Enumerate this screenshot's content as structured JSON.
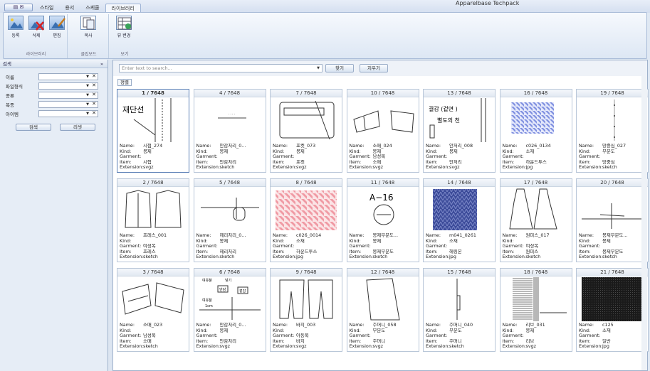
{
  "app": {
    "title": "Apparelbase Techpack",
    "app_button": "",
    "tabs": [
      "스타일",
      "용서",
      "스케줄",
      "라이브러리"
    ],
    "active_tab": 3
  },
  "ribbon": {
    "groups": [
      {
        "label": "라이브러리",
        "buttons": [
          {
            "label": "등록",
            "icon": "register-image-icon"
          },
          {
            "label": "삭제",
            "icon": "delete-image-icon"
          },
          {
            "label": "편집",
            "icon": "edit-image-icon"
          }
        ]
      },
      {
        "label": "클립보드",
        "buttons": [
          {
            "label": "복사",
            "icon": "copy-icon"
          }
        ]
      },
      {
        "label": "보기",
        "buttons": [
          {
            "label": "뷰 변경",
            "icon": "view-change-icon"
          }
        ]
      }
    ]
  },
  "search_panel": {
    "title": "검색",
    "pin": "»",
    "fields": [
      {
        "label": "이름"
      },
      {
        "label": "파일형식"
      },
      {
        "label": "종류"
      },
      {
        "label": "복종"
      },
      {
        "label": "아이템"
      }
    ],
    "search_button": "검색",
    "reset_button": "리셋"
  },
  "searchbar": {
    "placeholder": "Enter text to search...",
    "find_button": "찾기",
    "clear_button": "지우기"
  },
  "sort_label": "정렬",
  "labels": {
    "name": "Name:",
    "kind": "Kind:",
    "garment": "Garment:",
    "item": "Item:",
    "extension": "Extension:"
  },
  "cards": [
    {
      "index": "1 / 7648",
      "name": "시접_274",
      "kind": "봉제",
      "garment": "",
      "item": "시접",
      "ext": "svgz",
      "thumb": "seam",
      "selected": true
    },
    {
      "index": "4 / 7648",
      "name": "안감처리_0...",
      "kind": "봉제",
      "garment": "",
      "item": "안감처리",
      "ext": "sketch",
      "thumb": "lining"
    },
    {
      "index": "7 / 7648",
      "name": "포켓_073",
      "kind": "봉제",
      "garment": "",
      "item": "포켓",
      "ext": "svgz",
      "thumb": "pocket"
    },
    {
      "index": "10 / 7648",
      "name": "소매_024",
      "kind": "봉제",
      "garment": "남성복",
      "item": "소매",
      "ext": "svgz",
      "thumb": "sleeve"
    },
    {
      "index": "13 / 7648",
      "name": "안처리_008",
      "kind": "봉제",
      "garment": "",
      "item": "안처리",
      "ext": "svgz",
      "thumb": "textbox"
    },
    {
      "index": "16 / 7648",
      "name": "c026_0134",
      "kind": "소재",
      "garment": "",
      "item": "하운드투스",
      "ext": "jpg",
      "thumb": "houndblue"
    },
    {
      "index": "19 / 7648",
      "name": "망중심_027",
      "kind": "부분도",
      "garment": "",
      "item": "망중심",
      "ext": "sketch",
      "thumb": "dots"
    },
    {
      "index": "2 / 7648",
      "name": "프레스_001",
      "kind": "",
      "garment": "여성복",
      "item": "프레스",
      "ext": "sketch",
      "thumb": "coat"
    },
    {
      "index": "5 / 7648",
      "name": "헤리처리_0...",
      "kind": "봉제",
      "garment": "",
      "item": "헤리처리",
      "ext": "sketch",
      "thumb": "hem"
    },
    {
      "index": "8 / 7648",
      "name": "c026_0014",
      "kind": "소재",
      "garment": "",
      "item": "하운드투스",
      "ext": "jpg",
      "thumb": "houndred"
    },
    {
      "index": "11 / 7648",
      "name": "봉제부분도...",
      "kind": "봉제",
      "garment": "",
      "item": "봉제부분도",
      "ext": "sketch",
      "thumb": "a16"
    },
    {
      "index": "14 / 7648",
      "name": "m041_0261",
      "kind": "소재",
      "garment": "",
      "item": "헤링본",
      "ext": "jpg",
      "thumb": "herring"
    },
    {
      "index": "17 / 7648",
      "name": "원피스_017",
      "kind": "",
      "garment": "여성복",
      "item": "원피스",
      "ext": "sketch",
      "thumb": "dress"
    },
    {
      "index": "20 / 7648",
      "name": "봉제부분도...",
      "kind": "봉제",
      "garment": "",
      "item": "봉제부분도",
      "ext": "sketch",
      "thumb": "cross"
    },
    {
      "index": "3 / 7648",
      "name": "소매_023",
      "kind": "",
      "garment": "남성복",
      "item": "소매",
      "ext": "sketch",
      "thumb": "sleeve2"
    },
    {
      "index": "6 / 7648",
      "name": "안감처리_0...",
      "kind": "봉제",
      "garment": "",
      "item": "안감처리",
      "ext": "svgz",
      "thumb": "lining2"
    },
    {
      "index": "9 / 7648",
      "name": "바지_003",
      "kind": "",
      "garment": "아동복",
      "item": "바지",
      "ext": "svgz",
      "thumb": "pants"
    },
    {
      "index": "12 / 7648",
      "name": "주머니_058",
      "kind": "부분도",
      "garment": "",
      "item": "주머니",
      "ext": "svgz",
      "thumb": "skirt"
    },
    {
      "index": "15 / 7648",
      "name": "주머니_040",
      "kind": "부분도",
      "garment": "",
      "item": "주머니",
      "ext": "sketch",
      "thumb": "pocket2"
    },
    {
      "index": "18 / 7648",
      "name": "리브_031",
      "kind": "봉제",
      "garment": "",
      "item": "리브",
      "ext": "svgz",
      "thumb": "rib"
    },
    {
      "index": "21 / 7648",
      "name": "c125",
      "kind": "소재",
      "garment": "",
      "item": "일반",
      "ext": "jpg",
      "thumb": "dark"
    }
  ],
  "thumb_text": {
    "seam": "재단선",
    "textbox": "결감 (겉면 )",
    "textbox2": "별도의 천",
    "a16": "A−16",
    "lining2_a": "안감",
    "lining2_b": "겉감",
    "lining2_c": "여유분",
    "lining2_d": "1cm",
    "lining2_e": "넣기"
  }
}
